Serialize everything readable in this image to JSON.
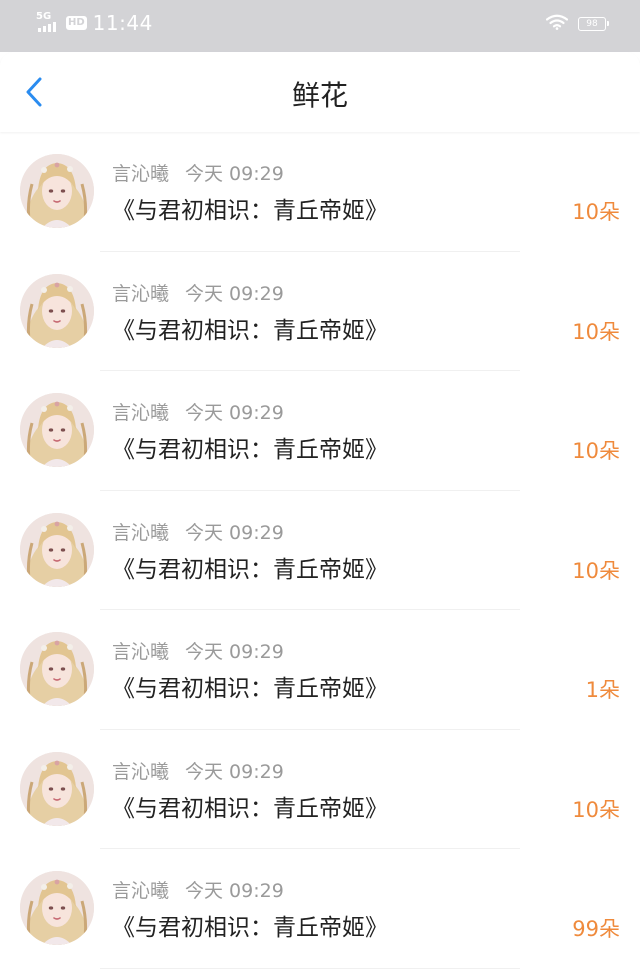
{
  "status_bar": {
    "network": "5G",
    "hd_label": "HD",
    "time": "11:44",
    "battery": "98"
  },
  "nav": {
    "title": "鲜花"
  },
  "colors": {
    "accent": "#2a8cf0",
    "count": "#ef8a3c"
  },
  "rows": [
    {
      "user": "言沁曦",
      "time": "今天 09:29",
      "title": "《与君初相识：青丘帝姬》",
      "count": "10朵"
    },
    {
      "user": "言沁曦",
      "time": "今天 09:29",
      "title": "《与君初相识：青丘帝姬》",
      "count": "10朵"
    },
    {
      "user": "言沁曦",
      "time": "今天 09:29",
      "title": "《与君初相识：青丘帝姬》",
      "count": "10朵"
    },
    {
      "user": "言沁曦",
      "time": "今天 09:29",
      "title": "《与君初相识：青丘帝姬》",
      "count": "10朵"
    },
    {
      "user": "言沁曦",
      "time": "今天 09:29",
      "title": "《与君初相识：青丘帝姬》",
      "count": "1朵"
    },
    {
      "user": "言沁曦",
      "time": "今天 09:29",
      "title": "《与君初相识：青丘帝姬》",
      "count": "10朵"
    },
    {
      "user": "言沁曦",
      "time": "今天 09:29",
      "title": "《与君初相识：青丘帝姬》",
      "count": "99朵"
    }
  ]
}
